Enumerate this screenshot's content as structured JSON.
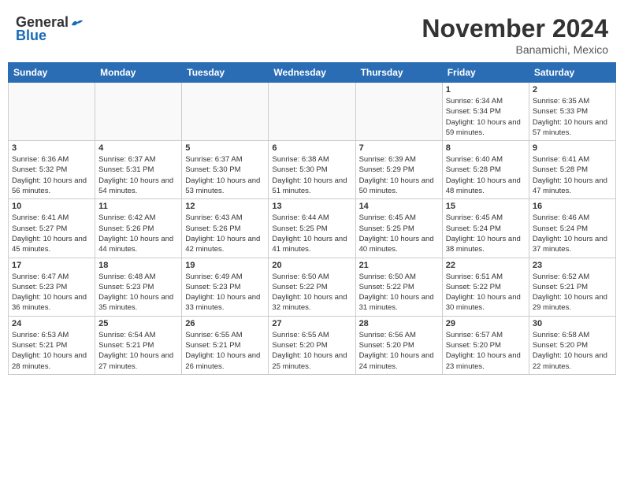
{
  "header": {
    "logo_general": "General",
    "logo_blue": "Blue",
    "month_title": "November 2024",
    "location": "Banamichi, Mexico"
  },
  "days_of_week": [
    "Sunday",
    "Monday",
    "Tuesday",
    "Wednesday",
    "Thursday",
    "Friday",
    "Saturday"
  ],
  "weeks": [
    [
      {
        "day": "",
        "info": ""
      },
      {
        "day": "",
        "info": ""
      },
      {
        "day": "",
        "info": ""
      },
      {
        "day": "",
        "info": ""
      },
      {
        "day": "",
        "info": ""
      },
      {
        "day": "1",
        "info": "Sunrise: 6:34 AM\nSunset: 5:34 PM\nDaylight: 10 hours and 59 minutes."
      },
      {
        "day": "2",
        "info": "Sunrise: 6:35 AM\nSunset: 5:33 PM\nDaylight: 10 hours and 57 minutes."
      }
    ],
    [
      {
        "day": "3",
        "info": "Sunrise: 6:36 AM\nSunset: 5:32 PM\nDaylight: 10 hours and 56 minutes."
      },
      {
        "day": "4",
        "info": "Sunrise: 6:37 AM\nSunset: 5:31 PM\nDaylight: 10 hours and 54 minutes."
      },
      {
        "day": "5",
        "info": "Sunrise: 6:37 AM\nSunset: 5:30 PM\nDaylight: 10 hours and 53 minutes."
      },
      {
        "day": "6",
        "info": "Sunrise: 6:38 AM\nSunset: 5:30 PM\nDaylight: 10 hours and 51 minutes."
      },
      {
        "day": "7",
        "info": "Sunrise: 6:39 AM\nSunset: 5:29 PM\nDaylight: 10 hours and 50 minutes."
      },
      {
        "day": "8",
        "info": "Sunrise: 6:40 AM\nSunset: 5:28 PM\nDaylight: 10 hours and 48 minutes."
      },
      {
        "day": "9",
        "info": "Sunrise: 6:41 AM\nSunset: 5:28 PM\nDaylight: 10 hours and 47 minutes."
      }
    ],
    [
      {
        "day": "10",
        "info": "Sunrise: 6:41 AM\nSunset: 5:27 PM\nDaylight: 10 hours and 45 minutes."
      },
      {
        "day": "11",
        "info": "Sunrise: 6:42 AM\nSunset: 5:26 PM\nDaylight: 10 hours and 44 minutes."
      },
      {
        "day": "12",
        "info": "Sunrise: 6:43 AM\nSunset: 5:26 PM\nDaylight: 10 hours and 42 minutes."
      },
      {
        "day": "13",
        "info": "Sunrise: 6:44 AM\nSunset: 5:25 PM\nDaylight: 10 hours and 41 minutes."
      },
      {
        "day": "14",
        "info": "Sunrise: 6:45 AM\nSunset: 5:25 PM\nDaylight: 10 hours and 40 minutes."
      },
      {
        "day": "15",
        "info": "Sunrise: 6:45 AM\nSunset: 5:24 PM\nDaylight: 10 hours and 38 minutes."
      },
      {
        "day": "16",
        "info": "Sunrise: 6:46 AM\nSunset: 5:24 PM\nDaylight: 10 hours and 37 minutes."
      }
    ],
    [
      {
        "day": "17",
        "info": "Sunrise: 6:47 AM\nSunset: 5:23 PM\nDaylight: 10 hours and 36 minutes."
      },
      {
        "day": "18",
        "info": "Sunrise: 6:48 AM\nSunset: 5:23 PM\nDaylight: 10 hours and 35 minutes."
      },
      {
        "day": "19",
        "info": "Sunrise: 6:49 AM\nSunset: 5:23 PM\nDaylight: 10 hours and 33 minutes."
      },
      {
        "day": "20",
        "info": "Sunrise: 6:50 AM\nSunset: 5:22 PM\nDaylight: 10 hours and 32 minutes."
      },
      {
        "day": "21",
        "info": "Sunrise: 6:50 AM\nSunset: 5:22 PM\nDaylight: 10 hours and 31 minutes."
      },
      {
        "day": "22",
        "info": "Sunrise: 6:51 AM\nSunset: 5:22 PM\nDaylight: 10 hours and 30 minutes."
      },
      {
        "day": "23",
        "info": "Sunrise: 6:52 AM\nSunset: 5:21 PM\nDaylight: 10 hours and 29 minutes."
      }
    ],
    [
      {
        "day": "24",
        "info": "Sunrise: 6:53 AM\nSunset: 5:21 PM\nDaylight: 10 hours and 28 minutes."
      },
      {
        "day": "25",
        "info": "Sunrise: 6:54 AM\nSunset: 5:21 PM\nDaylight: 10 hours and 27 minutes."
      },
      {
        "day": "26",
        "info": "Sunrise: 6:55 AM\nSunset: 5:21 PM\nDaylight: 10 hours and 26 minutes."
      },
      {
        "day": "27",
        "info": "Sunrise: 6:55 AM\nSunset: 5:20 PM\nDaylight: 10 hours and 25 minutes."
      },
      {
        "day": "28",
        "info": "Sunrise: 6:56 AM\nSunset: 5:20 PM\nDaylight: 10 hours and 24 minutes."
      },
      {
        "day": "29",
        "info": "Sunrise: 6:57 AM\nSunset: 5:20 PM\nDaylight: 10 hours and 23 minutes."
      },
      {
        "day": "30",
        "info": "Sunrise: 6:58 AM\nSunset: 5:20 PM\nDaylight: 10 hours and 22 minutes."
      }
    ]
  ]
}
